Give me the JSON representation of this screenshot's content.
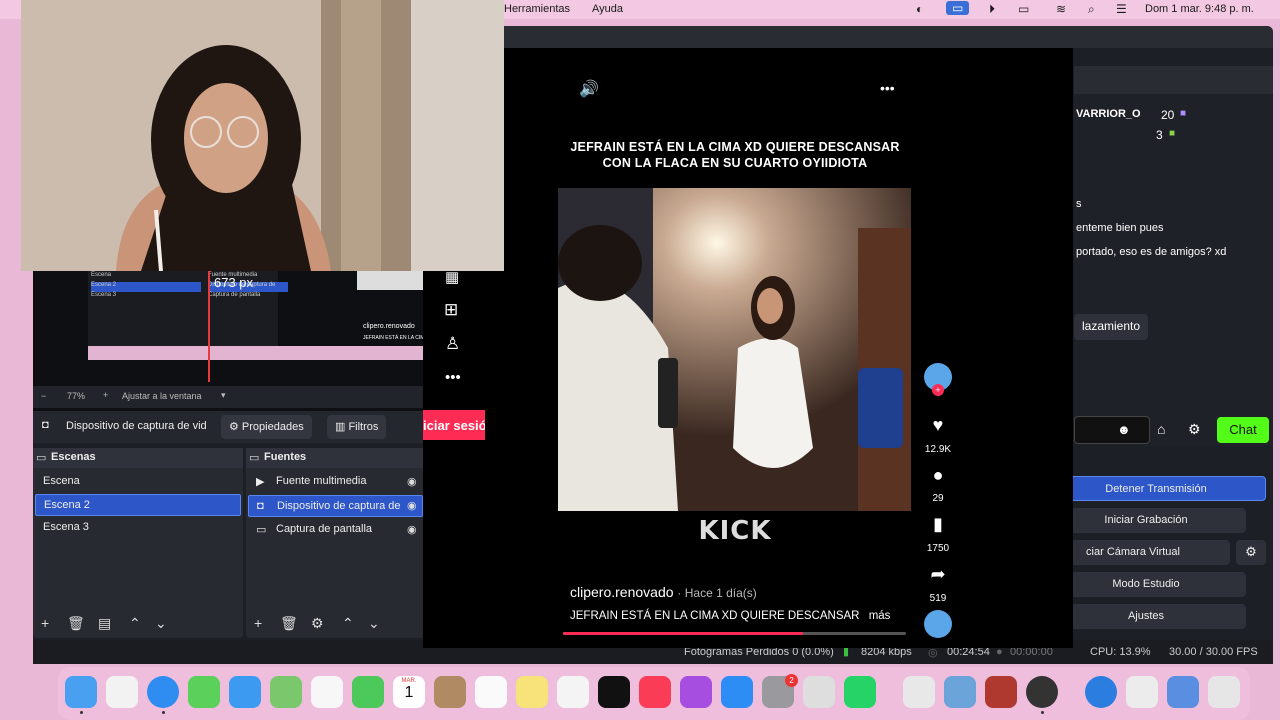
{
  "menubar": {
    "items": [
      "Herramientas",
      "Ayuda"
    ],
    "datetime": "Dom 1 mar.  9:48 p. m."
  },
  "obs": {
    "preview": {
      "scene_items": [
        "Escena",
        "Escena 2",
        "Escena 3"
      ],
      "source_items": [
        "Fuente multimedia",
        "Dispositivo de captura de",
        "Captura de pantalla"
      ],
      "size_label": "673 px",
      "mini_caption_1": "clipero.renovado",
      "mini_caption_2": "JEFRAIN ESTÁ EN LA CIMA"
    },
    "zoom": {
      "percent": "77%",
      "fit_label": "Ajustar a la ventana"
    },
    "toolbar": {
      "source_name": "Dispositivo de captura de vid",
      "properties": "Propiedades",
      "filters": "Filtros"
    },
    "scenes": {
      "title": "Escenas",
      "items": [
        "Escena",
        "Escena 2",
        "Escena 3"
      ],
      "selected": "Escena 2"
    },
    "sources": {
      "title": "Fuentes",
      "items": [
        "Fuente multimedia",
        "Dispositivo de captura de",
        "Captura de pantalla"
      ],
      "selected": "Dispositivo de captura de"
    },
    "controls": [
      "Detener Transmisión",
      "Iniciar Grabación",
      "ciar Cámara Virtual",
      "Modo Estudio",
      "Ajustes"
    ],
    "status": {
      "dropped": "Fotogramas Perdidos 0 (0.0%)",
      "bitrate": "8204 kbps",
      "stream_time": "00:24:54",
      "rec_time": "00:00:00",
      "cpu": "CPU: 13.9%",
      "fps": "30.00 / 30.00 FPS"
    },
    "chat": {
      "user1": "VARRIOR_O",
      "user1_count": "20",
      "user2_count": "3",
      "messages": [
        "s",
        "enteme bien pues",
        "portado, eso es de amigos? xd"
      ],
      "button": "lazamiento",
      "chat_button": "Chat"
    }
  },
  "tiktok": {
    "login_button": "iciar sesió",
    "caption": "JEFRAIN ESTÁ EN LA CIMA XD QUIERE DESCANSAR CON LA FLACA EN SU CUARTO OYIIDIOTA",
    "watermark": "KICK",
    "author": "clipero.renovado",
    "time": "· Hace 1 día(s)",
    "description": "JEFRAIN ESTÁ EN LA CIMA XD QUIERE DESCANSAR",
    "more": "más",
    "likes": "12.9K",
    "comments": "29",
    "saves": "1750",
    "shares": "519",
    "accent": "#fe2c55"
  },
  "dock_calendar": {
    "month": "MAR.",
    "day": "1"
  },
  "dock_badge": "2"
}
